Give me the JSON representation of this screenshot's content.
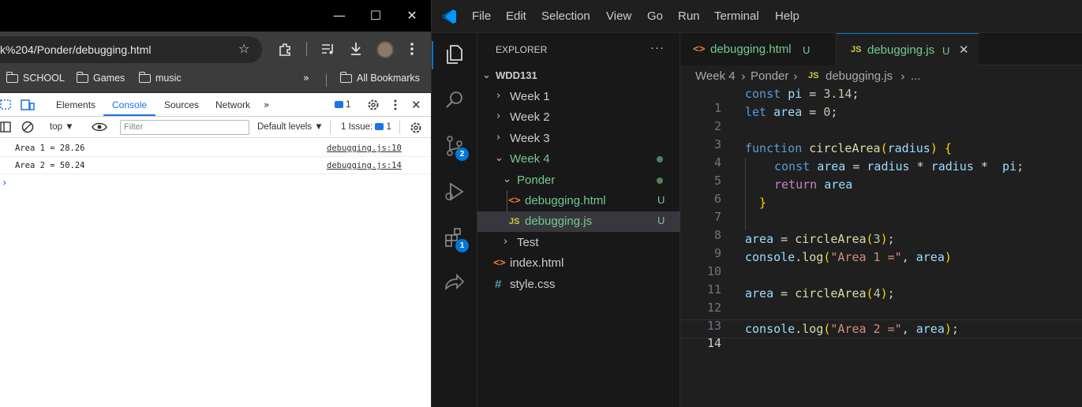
{
  "browser": {
    "url": "k%204/Ponder/debugging.html",
    "bookmarks": [
      {
        "label": "SCHOOL"
      },
      {
        "label": "Games"
      },
      {
        "label": "music"
      }
    ],
    "all_bookmarks": "All Bookmarks",
    "devtools": {
      "tabs": [
        "Elements",
        "Console",
        "Sources",
        "Network"
      ],
      "active_tab": "Console",
      "issues_badge": "1",
      "context": "top",
      "filter_placeholder": "Filter",
      "levels": "Default levels",
      "issue_label": "1 Issue:",
      "issue_count": "1",
      "console_lines": [
        {
          "message": "Area 1 = 28.26",
          "source": "debugging.js:10"
        },
        {
          "message": "Area 2 = 50.24",
          "source": "debugging.js:14"
        }
      ],
      "prompt": "›"
    }
  },
  "vscode": {
    "menu": [
      "File",
      "Edit",
      "Selection",
      "View",
      "Go",
      "Run",
      "Terminal",
      "Help"
    ],
    "activity_badges": {
      "source_control": "2",
      "extensions": "1"
    },
    "explorer": {
      "title": "EXPLORER",
      "more": "···",
      "root": "WDD131",
      "items": [
        {
          "label": "Week 1"
        },
        {
          "label": "Week 2"
        },
        {
          "label": "Week 3"
        },
        {
          "label": "Week 4"
        },
        {
          "label": "Ponder"
        },
        {
          "label": "debugging.html",
          "status": "U"
        },
        {
          "label": "debugging.js",
          "status": "U"
        },
        {
          "label": "Test"
        },
        {
          "label": "index.html"
        },
        {
          "label": "style.css"
        }
      ]
    },
    "tabs": [
      {
        "label": "debugging.html",
        "status": "U"
      },
      {
        "label": "debugging.js",
        "status": "U"
      }
    ],
    "breadcrumb": [
      "Week 4",
      "Ponder",
      "debugging.js",
      "..."
    ],
    "line_numbers": [
      "1",
      "2",
      "3",
      "4",
      "5",
      "6",
      "7",
      "8",
      "9",
      "10",
      "11",
      "12",
      "13",
      "14"
    ],
    "code": {
      "l1": [
        "const",
        "pi",
        "=",
        "3.14",
        ";"
      ],
      "l2": [
        "let",
        "area",
        "=",
        "0",
        ";"
      ],
      "l4": [
        "function",
        "circleArea",
        "(",
        "radius",
        ")",
        "{"
      ],
      "l5": [
        "const",
        "area",
        "=",
        "radius",
        "*",
        "radius",
        "*",
        "pi",
        ";"
      ],
      "l6": [
        "return",
        "area"
      ],
      "l7": [
        "}"
      ],
      "l9": [
        "area",
        "=",
        "circleArea",
        "(",
        "3",
        ")",
        ";"
      ],
      "l10": [
        "console",
        ".",
        "log",
        "(",
        "\"Area 1 =\"",
        ",",
        "area",
        ")"
      ],
      "l12": [
        "area",
        "=",
        "circleArea",
        "(",
        "4",
        ")",
        ";"
      ],
      "l14": [
        "console",
        ".",
        "log",
        "(",
        "\"Area 2 =\"",
        ",",
        "area",
        ")",
        ";"
      ]
    },
    "colors": {
      "accent": "#0078d4",
      "untracked": "#73c991",
      "string": "#ce9178",
      "keyword": "#569cd6"
    }
  }
}
